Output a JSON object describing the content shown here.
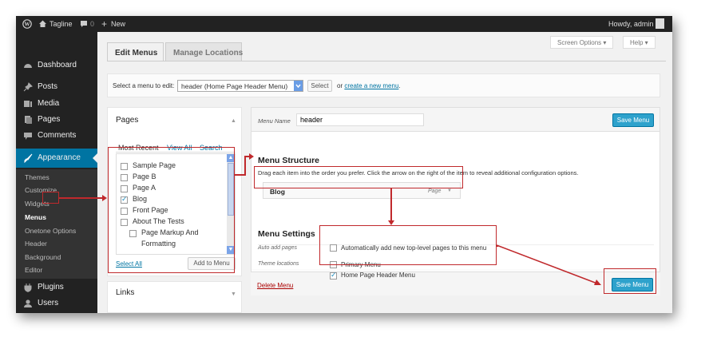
{
  "admin_bar": {
    "site_name": "Tagline",
    "comments_count": "0",
    "new_label": "New",
    "greeting": "Howdy, admin"
  },
  "sidebar": {
    "items": [
      {
        "label": "Dashboard",
        "icon": "dashboard-icon"
      },
      {
        "label": "Posts",
        "icon": "pin-icon"
      },
      {
        "label": "Media",
        "icon": "media-icon"
      },
      {
        "label": "Pages",
        "icon": "pages-icon"
      },
      {
        "label": "Comments",
        "icon": "comment-icon"
      },
      {
        "label": "Appearance",
        "icon": "brush-icon",
        "active": true
      },
      {
        "label": "Plugins",
        "icon": "plug-icon"
      },
      {
        "label": "Users",
        "icon": "user-icon"
      }
    ],
    "appearance_submenu": [
      "Themes",
      "Customize",
      "Widgets",
      "Menus",
      "Onetone Options",
      "Header",
      "Background",
      "Editor"
    ],
    "current_submenu": "Menus"
  },
  "screen_options_label": "Screen Options ▾",
  "help_label": "Help ▾",
  "tabs": [
    "Edit Menus",
    "Manage Locations"
  ],
  "select_menu": {
    "label": "Select a menu to edit:",
    "selected": "header (Home Page Header Menu)",
    "select_button": "Select",
    "or_text": "or",
    "create_link": "create a new menu"
  },
  "pages_box": {
    "title": "Pages",
    "tabs": [
      "Most Recent",
      "View All",
      "Search"
    ],
    "items": [
      {
        "label": "Sample Page",
        "checked": false,
        "indent": false
      },
      {
        "label": "Page B",
        "checked": false,
        "indent": false
      },
      {
        "label": "Page A",
        "checked": false,
        "indent": false
      },
      {
        "label": "Blog",
        "checked": true,
        "indent": false
      },
      {
        "label": "Front Page",
        "checked": false,
        "indent": false
      },
      {
        "label": "About The Tests",
        "checked": false,
        "indent": false
      },
      {
        "label": "Page Markup And",
        "checked": false,
        "indent": true
      },
      {
        "label": "Formatting",
        "checked": null,
        "indent": true
      }
    ],
    "select_all": "Select All",
    "add_button": "Add to Menu"
  },
  "links_box": {
    "title": "Links"
  },
  "menu_edit": {
    "name_label": "Menu Name",
    "name_value": "header",
    "save_label": "Save Menu",
    "structure_title": "Menu Structure",
    "structure_desc": "Drag each item into the order you prefer. Click the arrow on the right of the item to reveal additional configuration options.",
    "menu_item": {
      "title": "Blog",
      "type": "Page"
    },
    "settings_title": "Menu Settings",
    "auto_add_label": "Auto add pages",
    "auto_add_text": "Automatically add new top-level pages to this menu",
    "auto_add_checked": false,
    "locations_label": "Theme locations",
    "locations": [
      {
        "label": "Primary Menu",
        "checked": false
      },
      {
        "label": "Home Page Header Menu",
        "checked": true
      }
    ],
    "delete_label": "Delete Menu"
  },
  "colors": {
    "annotation": "#c0292c",
    "accent": "#0074a2",
    "button_primary": "#2ea2cc"
  }
}
